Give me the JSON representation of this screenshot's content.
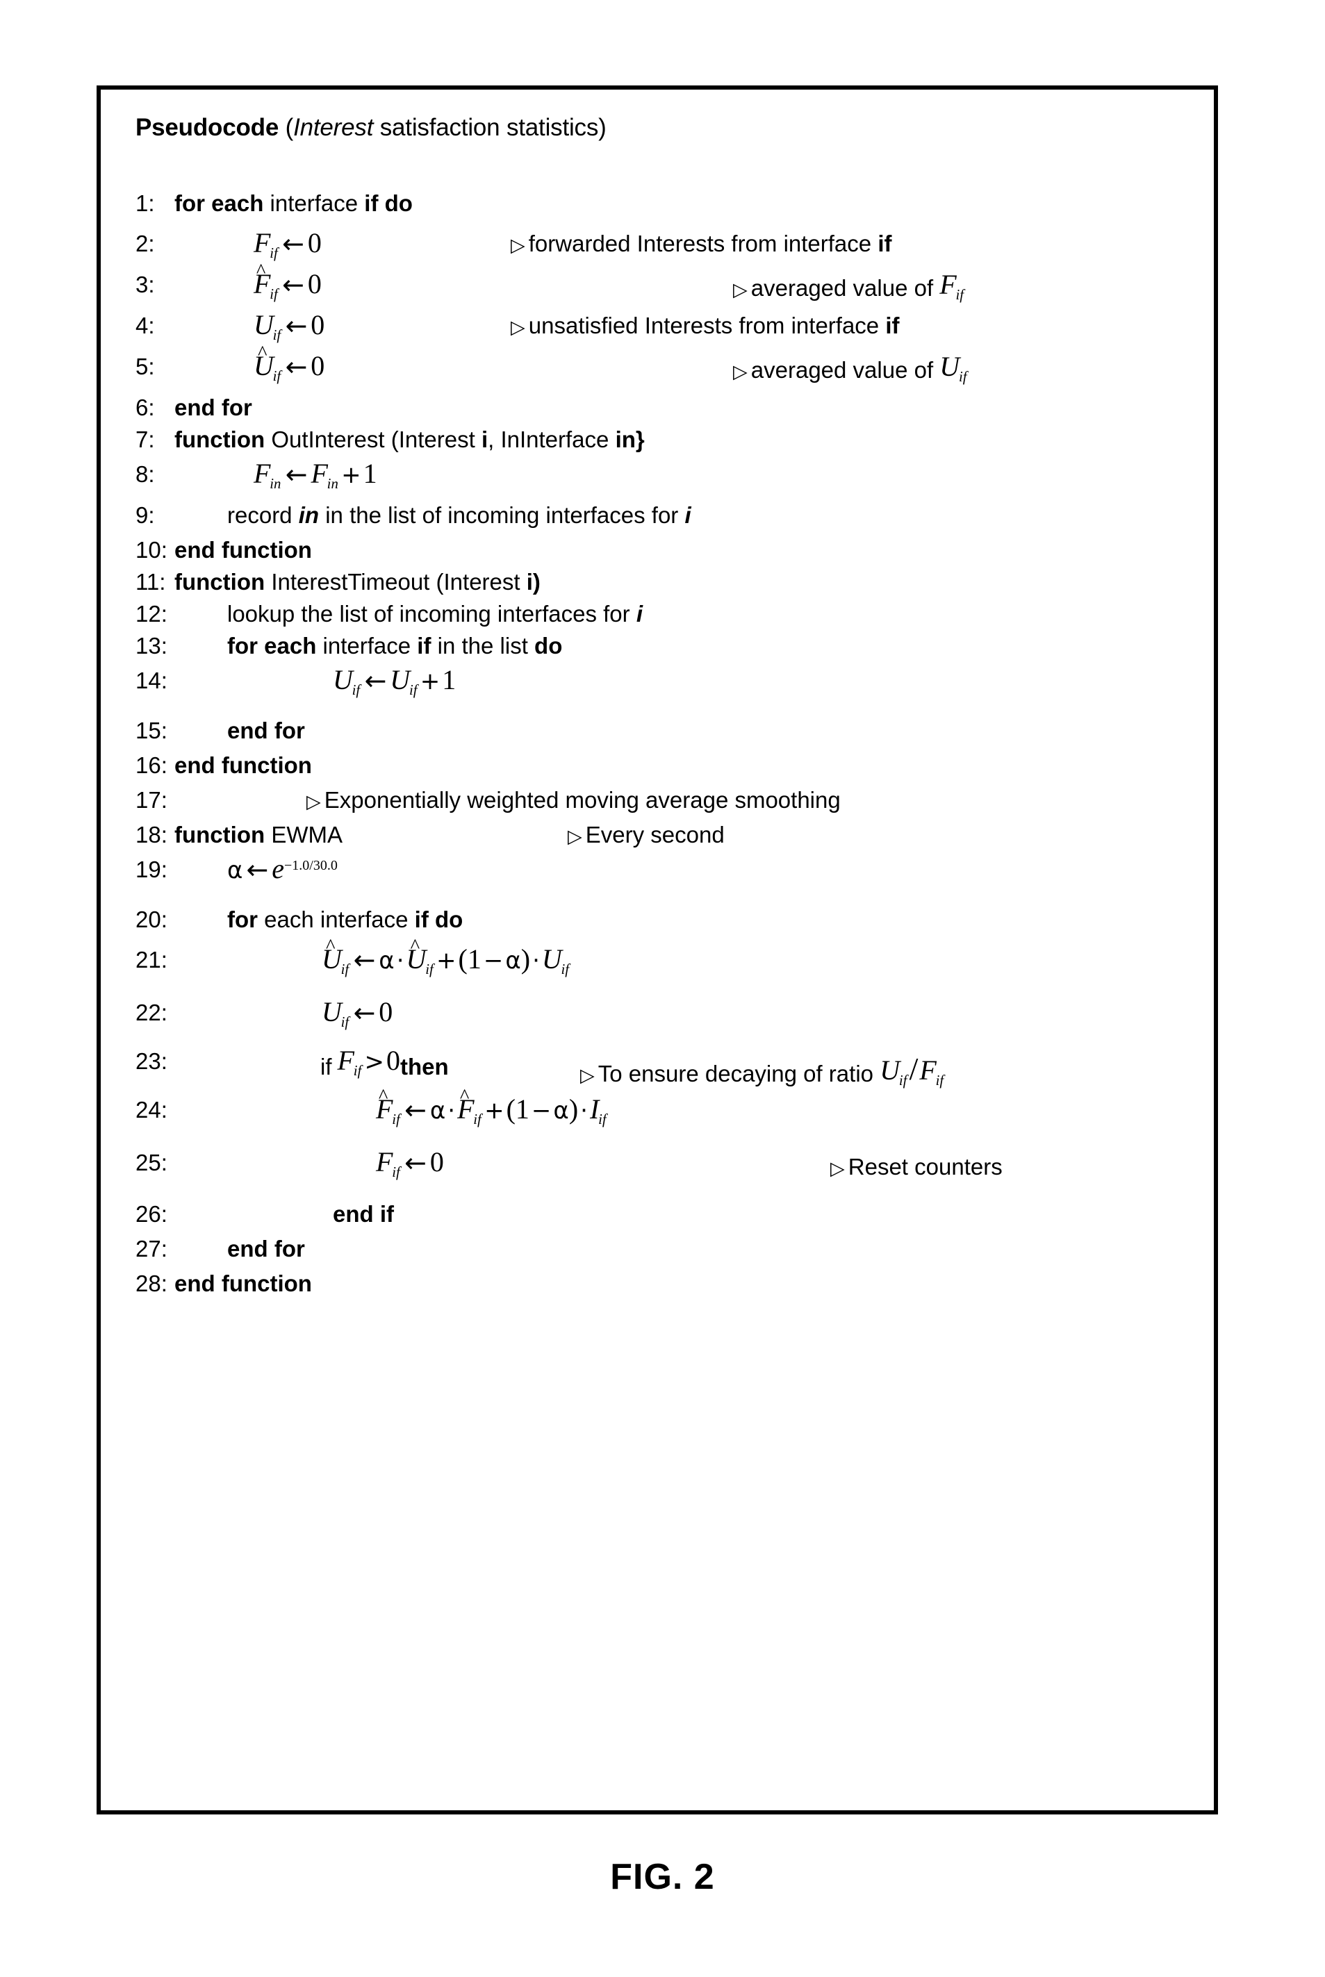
{
  "figure": {
    "caption": "FIG. 2",
    "title": {
      "bold_part": "Pseudocode",
      "paren_open": " (",
      "italic_word": "Interest",
      "rest": " satisfaction statistics)"
    }
  },
  "pseudocode": {
    "lines": [
      {
        "num": "1:",
        "text": "for each interface if do"
      },
      {
        "num": "2:",
        "text": "F_if ← 0",
        "comment": "▷ forwarded Interests from interface if"
      },
      {
        "num": "3:",
        "text": "F̂_if ← 0",
        "comment": "▷ averaged value of F_if"
      },
      {
        "num": "4:",
        "text": "U_if ← 0",
        "comment": "▷ unsatisfied Interests from interface if"
      },
      {
        "num": "5:",
        "text": "Û_if ← 0",
        "comment": "▷ averaged value of U_if"
      },
      {
        "num": "6:",
        "text": "end for"
      },
      {
        "num": "7:",
        "text": "function OutInterest (Interest i, InInterface in}"
      },
      {
        "num": "8:",
        "text": "F_in ← F_in + 1"
      },
      {
        "num": "9:",
        "text": "record in in the list of incoming interfaces for i"
      },
      {
        "num": "10:",
        "text": "end function"
      },
      {
        "num": "11:",
        "text": "function InterestTimeout (Interest i)"
      },
      {
        "num": "12:",
        "text": "lookup the list of incoming interfaces for i"
      },
      {
        "num": "13:",
        "text": "for each interface if in the list do"
      },
      {
        "num": "14:",
        "text": "U_if ← U_if + 1"
      },
      {
        "num": "15:",
        "text": "end for"
      },
      {
        "num": "16:",
        "text": "end function"
      },
      {
        "num": "17:",
        "text": "",
        "comment": "▷ Exponentially weighted moving average smoothing"
      },
      {
        "num": "18:",
        "text": "function EWMA",
        "comment": "▷ Every second"
      },
      {
        "num": "19:",
        "text": "α ← e^(−1.0/30.0)"
      },
      {
        "num": "20:",
        "text": "for each interface if do"
      },
      {
        "num": "21:",
        "text": "Û_if ← α · Û_if + (1 − α) · U_if"
      },
      {
        "num": "22:",
        "text": "U_if ← 0"
      },
      {
        "num": "23:",
        "text": "if F_if > 0 then",
        "comment": "▷ To ensure decaying of ratio U_if / F_if"
      },
      {
        "num": "24:",
        "text": "F̂_if ← α · F̂_if + (1 − α) · I_if"
      },
      {
        "num": "25:",
        "text": "F_if ← 0",
        "comment": "▷ Reset counters"
      },
      {
        "num": "26:",
        "text": "end if"
      },
      {
        "num": "27:",
        "text": "end for"
      },
      {
        "num": "28:",
        "text": "end function"
      }
    ],
    "keywords": {
      "for_each": "for each",
      "for": "for",
      "do": "do",
      "end_for": "end for",
      "function": "function",
      "end_function": "end function",
      "end_if": "end if",
      "then": "then",
      "if_kw": "if"
    },
    "labels": {
      "l1_rest": "interface",
      "l1_ifdo": "if do",
      "l2_cmt": "forwarded Interests from interface",
      "l2_cmt_if": "if",
      "l3_cmt": "averaged value of",
      "l4_cmt": "unsatisfied Interests from interface",
      "l4_cmt_if": "if",
      "l5_cmt": "averaged value of",
      "l7_name": "OutInterest (Interest",
      "l7_i": "i",
      "l7_mid": ", InInterface",
      "l7_in": "in}",
      "l9_record": "record",
      "l9_in": "in",
      "l9_rest": "in the list of incoming interfaces for",
      "l9_i": "i",
      "l11_name": "InterestTimeout (Interest",
      "l11_i": "i)",
      "l12_text": "lookup the list of incoming interfaces for",
      "l12_i": "i",
      "l13_rest": "interface",
      "l13_if": "if",
      "l13_inlist": "in the list",
      "l13_do": "do",
      "l17_cmt": "Exponentially weighted moving average smoothing",
      "l18_ewma": "EWMA",
      "l18_cmt": "Every second",
      "l20_each": "each interface",
      "l20_ifdo": "if do",
      "l23_if": "if",
      "l23_then": "then",
      "l23_cmt": "To ensure decaying of ratio",
      "l25_cmt": "Reset counters"
    },
    "math": {
      "F": "F",
      "U": "U",
      "I": "I",
      "e": "e",
      "sub_if": "if",
      "sub_in": "in",
      "zero": "0",
      "one": "1",
      "arrow": "←",
      "plus": "+",
      "minus": "−",
      "dot": "·",
      "gt": ">",
      "alpha": "α",
      "hat": "^",
      "exp": "−1.0/30.0",
      "paren_open": "(",
      "paren_close": ")",
      "slash": "/"
    },
    "marker": "▷"
  }
}
